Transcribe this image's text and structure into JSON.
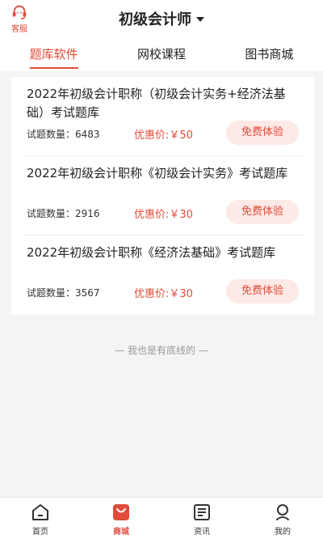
{
  "header": {
    "service_label": "客服",
    "title": "初级会计师"
  },
  "tabs": [
    {
      "label": "题库软件",
      "active": true
    },
    {
      "label": "网校课程",
      "active": false
    },
    {
      "label": "图书商城",
      "active": false
    }
  ],
  "items": [
    {
      "title": "2022年初级会计职称（初级会计实务+经济法基础）考试题库",
      "count_text": "试题数量：6483",
      "price_text": "优惠价:￥50",
      "button_label": "免费体验"
    },
    {
      "title": "2022年初级会计职称《初级会计实务》考试题库",
      "count_text": "试题数量：2916",
      "price_text": "优惠价:￥30",
      "button_label": "免费体验"
    },
    {
      "title": "2022年初级会计职称《经济法基础》考试题库",
      "count_text": "试题数量：3567",
      "price_text": "优惠价:￥30",
      "button_label": "免费体验"
    }
  ],
  "footer_note": "— 我也是有底线的 —",
  "bottom_nav": [
    {
      "label": "首页",
      "icon": "home-icon",
      "active": false
    },
    {
      "label": "商城",
      "icon": "shop-bag-icon",
      "active": true
    },
    {
      "label": "资讯",
      "icon": "news-icon",
      "active": false
    },
    {
      "label": "我的",
      "icon": "user-icon",
      "active": false
    }
  ],
  "colors": {
    "accent": "#e14b3a",
    "button_bg": "#fde9e6",
    "page_bg": "#f4f4f4"
  }
}
